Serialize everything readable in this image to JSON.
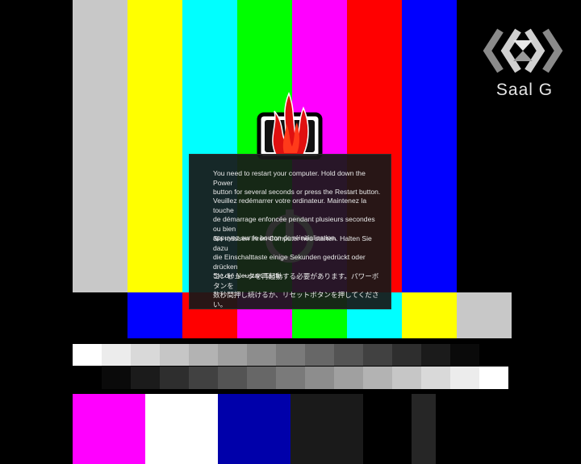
{
  "channel": {
    "name": "Saal G",
    "logo": "saal-g-logo-icon"
  },
  "panic": {
    "watermark_icon": "power-icon",
    "messages": [
      {
        "lang": "en",
        "text": "You need to restart your computer. Hold down the Power\nbutton for several seconds or press the Restart button."
      },
      {
        "lang": "fr",
        "text": "Veuillez redémarrer votre ordinateur. Maintenez la touche\nde démarrage enfoncée pendant plusieurs secondes ou bien\nappuyez sur le bouton de réinitialisation."
      },
      {
        "lang": "de",
        "text": "Sie müssen Ihren Computer neu starten. Halten Sie dazu\ndie Einschalttaste einige Sekunden gedrückt oder drücken\nSie die Neustart-Taste."
      },
      {
        "lang": "ja",
        "text": "コンピュータを再起動する必要があります。パワーボタンを\n数秒間押し続けるか、リセットボタンを押してください。"
      }
    ]
  },
  "emblem": {
    "icon": "flame-icon"
  },
  "test_pattern": {
    "top_colors": [
      "#c8c8c8",
      "#ffff00",
      "#00ffff",
      "#00ff00",
      "#ff00ff",
      "#ff0000",
      "#0000ff"
    ],
    "middle_colors": [
      "#000000",
      "#0000ff",
      "#ff0000",
      "#ff00ff",
      "#00ff00",
      "#00ffff",
      "#ffff00",
      "#c8c8c8"
    ],
    "gray_top": [
      "#ffffff",
      "#ececec",
      "#d9d9d9",
      "#c6c6c6",
      "#b3b3b3",
      "#a0a0a0",
      "#8d8d8d",
      "#7a7a7a",
      "#676767",
      "#545454",
      "#414141",
      "#2e2e2e",
      "#1b1b1b",
      "#0a0a0a",
      "#000000"
    ],
    "gray_bottom": [
      "#000000",
      "#0a0a0a",
      "#1b1b1b",
      "#2e2e2e",
      "#414141",
      "#545454",
      "#676767",
      "#7a7a7a",
      "#8d8d8d",
      "#a0a0a0",
      "#b3b3b3",
      "#c6c6c6",
      "#d9d9d9",
      "#ececec",
      "#ffffff"
    ],
    "bottom_colors": [
      "#ff00ff",
      "#ffffff",
      "#0000aa",
      "#1a1a1a",
      "#000000",
      "#262626"
    ]
  }
}
